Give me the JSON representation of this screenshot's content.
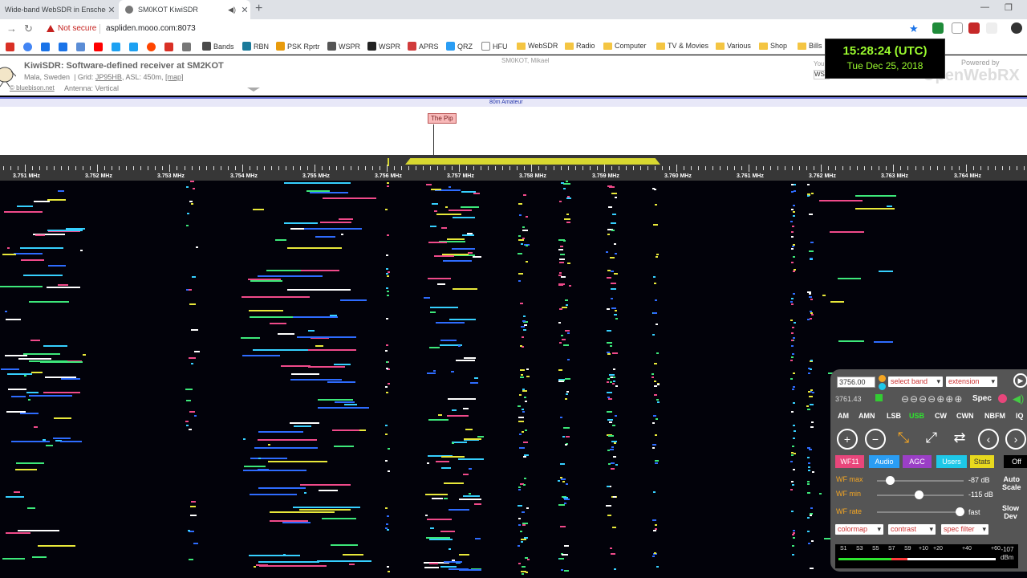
{
  "browser": {
    "tabs": [
      {
        "title": "Wide-band WebSDR in Enschede",
        "close": "✕"
      },
      {
        "title": "SM0KOT KiwiSDR",
        "close": "✕",
        "audio_icon": "speaker-icon"
      }
    ],
    "new_tab": "+",
    "window_controls": [
      "—",
      "❐"
    ],
    "security_label": "Not secure",
    "url": "aspliden.mooo.com:8073",
    "bookmarks": [
      {
        "label": "Bands",
        "icon": "bands-icon",
        "color": "#4a4a4a"
      },
      {
        "label": "RBN",
        "icon": "rbn-icon",
        "color": "#1a7a9a"
      },
      {
        "label": "PSK Rprtr",
        "icon": "psk-icon",
        "color": "#e89b0c"
      },
      {
        "label": "WSPR",
        "icon": "wspr-icon",
        "color": "#555555"
      },
      {
        "label": "WSPR",
        "icon": "wspr2-icon",
        "color": "#222222"
      },
      {
        "label": "APRS",
        "icon": "aprs-icon",
        "color": "#d13b3b"
      },
      {
        "label": "QRZ",
        "icon": "qrz-icon",
        "color": "#2a9df4"
      },
      {
        "label": "HFU",
        "icon": "page-icon",
        "color": "#ffffff"
      },
      {
        "label": "WebSDR",
        "icon": "folder-icon",
        "color": "#f4c542"
      },
      {
        "label": "Radio",
        "icon": "folder-icon",
        "color": "#f4c542"
      },
      {
        "label": "Computer",
        "icon": "folder-icon",
        "color": "#f4c542"
      },
      {
        "label": "TV & Movies",
        "icon": "folder-icon",
        "color": "#f4c542"
      },
      {
        "label": "Various",
        "icon": "folder-icon",
        "color": "#f4c542"
      },
      {
        "label": "Shop",
        "icon": "folder-icon",
        "color": "#f4c542"
      },
      {
        "label": "Bills",
        "icon": "folder-icon",
        "color": "#f4c542"
      }
    ]
  },
  "header": {
    "title": "KiwiSDR: Software-defined receiver at SM2KOT",
    "location": "Mala, Sweden",
    "grid_prefix": "| Grid:",
    "grid": "JP95HB",
    "asl": ", ASL: 450m,",
    "map_link": "[map]",
    "credit": "© bluebison.net",
    "antenna": "Antenna: Vertical",
    "owner": "SM0KOT, Mikael",
    "you_label": "You",
    "you_value": "WS",
    "powered_by": "Powered by",
    "openwebrx": "OpenWebRX"
  },
  "clock": {
    "time": "15:28:24 (UTC)",
    "date": "Tue Dec 25, 2018"
  },
  "band": {
    "name": "80m Amateur",
    "label_marker": "The Pip"
  },
  "scale": {
    "freq_labels": [
      "3.751 MHz",
      "3.752 MHz",
      "3.753 MHz",
      "3.754 MHz",
      "3.755 MHz",
      "3.756 MHz",
      "3.757 MHz",
      "3.758 MHz",
      "3.759 MHz",
      "3.760 MHz",
      "3.761 MHz",
      "3.762 MHz",
      "3.763 MHz",
      "3.764 MHz"
    ]
  },
  "panel": {
    "frequency": "3756.00",
    "select_band": "select band",
    "extension": "extension",
    "sub_freq": "3761.43",
    "zoom_icons": "⊖⊖⊖⊖⊕⊕⊕",
    "spec_label": "Spec",
    "modes": [
      "AM",
      "AMN",
      "LSB",
      "USB",
      "CW",
      "CWN",
      "NBFM",
      "IQ"
    ],
    "active_mode": "USB",
    "tabs": [
      {
        "label": "WF11",
        "color": "#e8467b"
      },
      {
        "label": "Audio",
        "color": "#2a9df4"
      },
      {
        "label": "AGC",
        "color": "#9b3fc6"
      },
      {
        "label": "Users",
        "color": "#1ec8e8"
      },
      {
        "label": "Stats",
        "color": "#e8d91e"
      },
      {
        "label": "Off",
        "color": "#000000"
      }
    ],
    "wf_max": {
      "label": "WF max",
      "value": "-87 dB",
      "level": 0.15
    },
    "wf_min": {
      "label": "WF min",
      "value": "-115 dB",
      "level": 0.48
    },
    "wf_rate": {
      "label": "WF rate",
      "value": "fast",
      "level": 0.95
    },
    "auto_scale": "Auto\nScale",
    "slow_dev": "Slow\nDev",
    "colormap": "colormap",
    "contrast": "contrast",
    "spec_filter": "spec filter",
    "smeter_labels": [
      "S1",
      "S3",
      "S5",
      "S7",
      "S9",
      "+10",
      "+20",
      "+40",
      "+60"
    ],
    "smeter_dbm": "-107\ndBm"
  }
}
